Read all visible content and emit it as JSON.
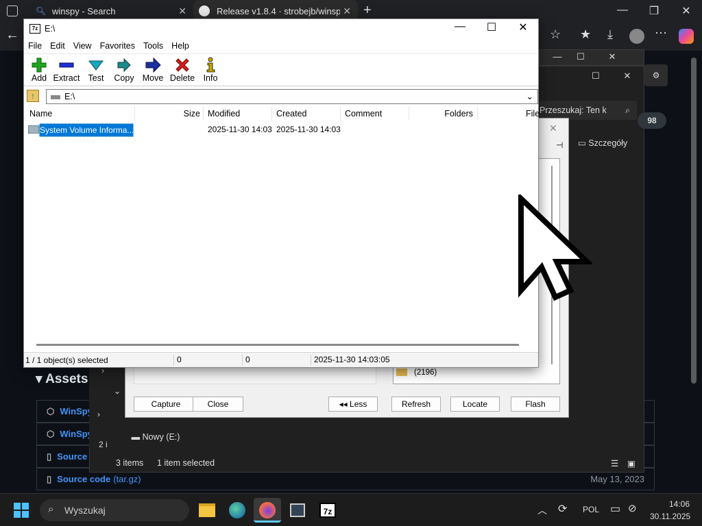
{
  "browser": {
    "tabs": [
      {
        "label": "winspy - Search"
      },
      {
        "label": "Release v1.8.4 · strobejb/winspy"
      }
    ],
    "github": {
      "assets_title": "Assets",
      "badge": "98",
      "assets": [
        {
          "label": "WinSpy"
        },
        {
          "label": "WinSpy"
        },
        {
          "label": "Source code"
        },
        {
          "label": "Source code",
          "suffix": "(tar.gz)",
          "date": "May 13, 2023"
        }
      ]
    }
  },
  "explorer": {
    "search_placeholder": "Przeszukaj: Ten k",
    "details_label": "Szczegóły",
    "tree_item": "Nowy (E:)",
    "count_partial": "2 i",
    "status_items": "3 items",
    "status_selected": "1 item selected"
  },
  "sevenzip": {
    "title": "E:\\",
    "menu": [
      "File",
      "Edit",
      "View",
      "Favorites",
      "Tools",
      "Help"
    ],
    "tools": [
      {
        "label": "Add",
        "icon": "plus-icon",
        "color": "#1fa51f"
      },
      {
        "label": "Extract",
        "icon": "minus-icon",
        "color": "#1d2fd6"
      },
      {
        "label": "Test",
        "icon": "check-icon",
        "color": "#16a8c0"
      },
      {
        "label": "Copy",
        "icon": "double-arrow-icon",
        "color": "#1b8a8a"
      },
      {
        "label": "Move",
        "icon": "arrow-right-icon",
        "color": "#1b2f9e"
      },
      {
        "label": "Delete",
        "icon": "x-icon",
        "color": "#d81e1e"
      },
      {
        "label": "Info",
        "icon": "info-icon",
        "color": "#c8a800"
      }
    ],
    "address": "E:\\",
    "columns": [
      "Name",
      "Size",
      "Modified",
      "Created",
      "Comment",
      "Folders",
      "File"
    ],
    "rows": [
      {
        "name": "System Volume Informa...",
        "size": "",
        "modified": "2025-11-30 14:03",
        "created": "2025-11-30 14:03"
      }
    ],
    "status": {
      "selected": "1 / 1 object(s) selected",
      "size1": "0",
      "size2": "0",
      "date": "2025-11-30 14:03:05"
    }
  },
  "winspy": {
    "tree_count": "(2196)",
    "buttons": {
      "capture": "Capture",
      "close": "Close",
      "less": "Less",
      "refresh": "Refresh",
      "locate": "Locate",
      "flash": "Flash"
    }
  },
  "taskbar": {
    "search": "Wyszukaj",
    "language": "POL",
    "time": "14:06",
    "date": "30.11.2025"
  },
  "colors": {
    "selection": "#0078d7",
    "taskbar": "#1c1c1c",
    "github_bg": "#0d1117",
    "link": "#4493f8"
  }
}
